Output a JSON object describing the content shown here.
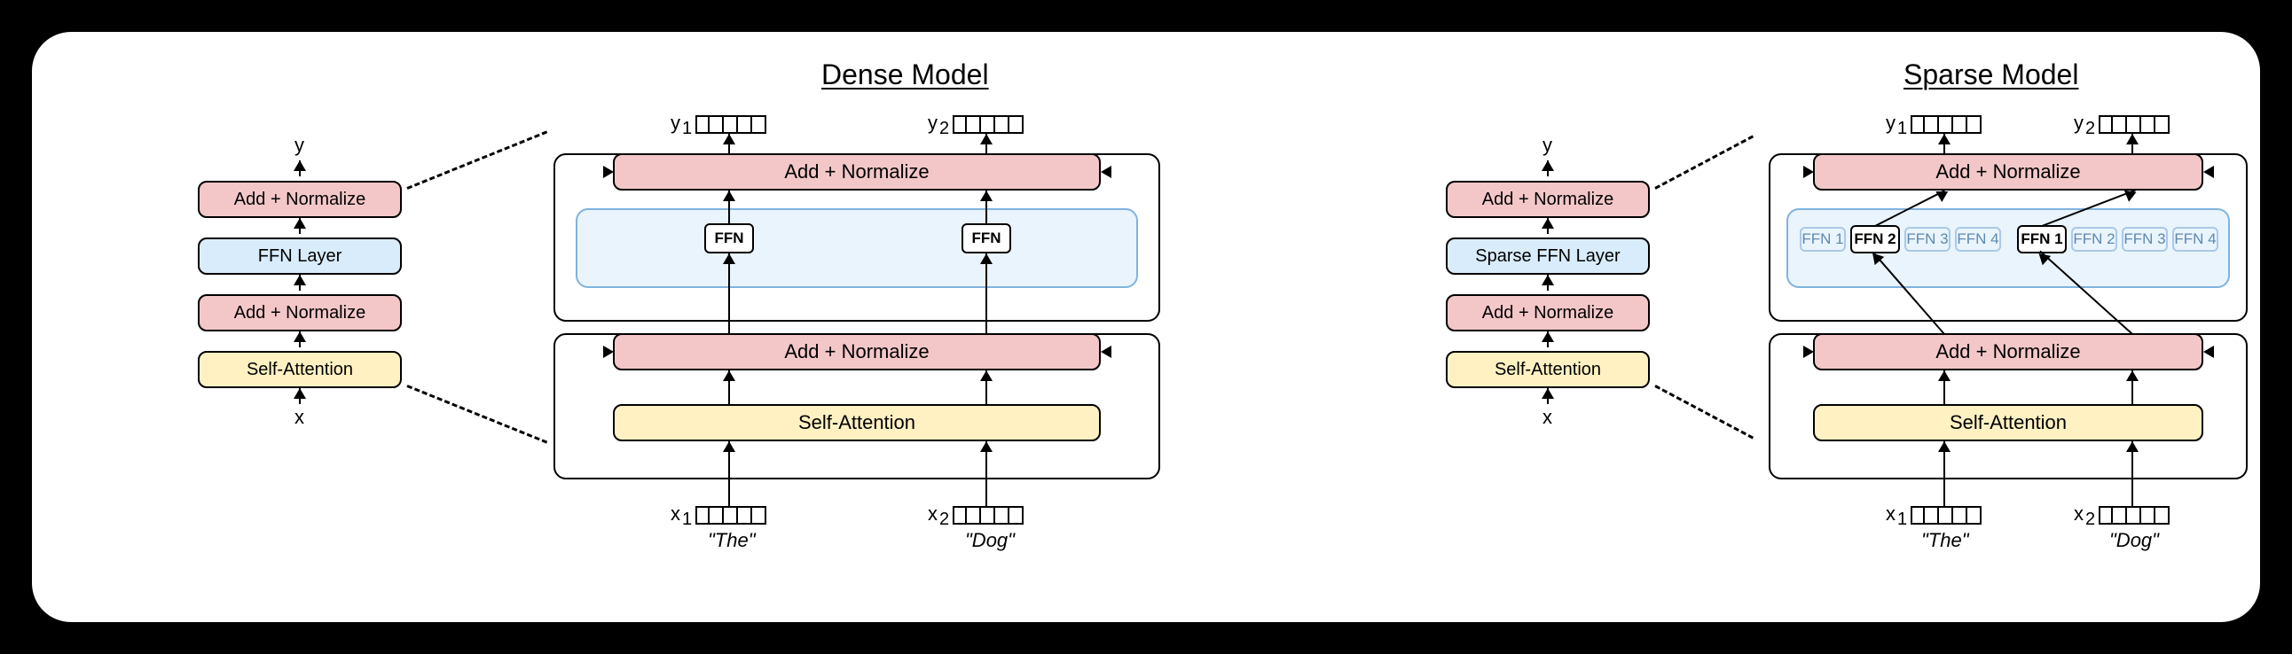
{
  "titles": {
    "dense": "Dense Model",
    "sparse": "Sparse Model"
  },
  "io": {
    "x": "x",
    "y": "y",
    "x1": "x",
    "x2": "x",
    "y1": "y",
    "y2": "y",
    "sub1": "1",
    "sub2": "2"
  },
  "tokens": {
    "the": "\"The\"",
    "dog": "\"Dog\""
  },
  "blocks": {
    "addnorm": "Add + Normalize",
    "ffn_layer": "FFN Layer",
    "sparse_ffn_layer": "Sparse FFN Layer",
    "self_attn": "Self-Attention",
    "ffn": "FFN"
  },
  "experts": {
    "e1": "FFN 1",
    "e2": "FFN 2",
    "e3": "FFN 3",
    "e4": "FFN 4"
  }
}
